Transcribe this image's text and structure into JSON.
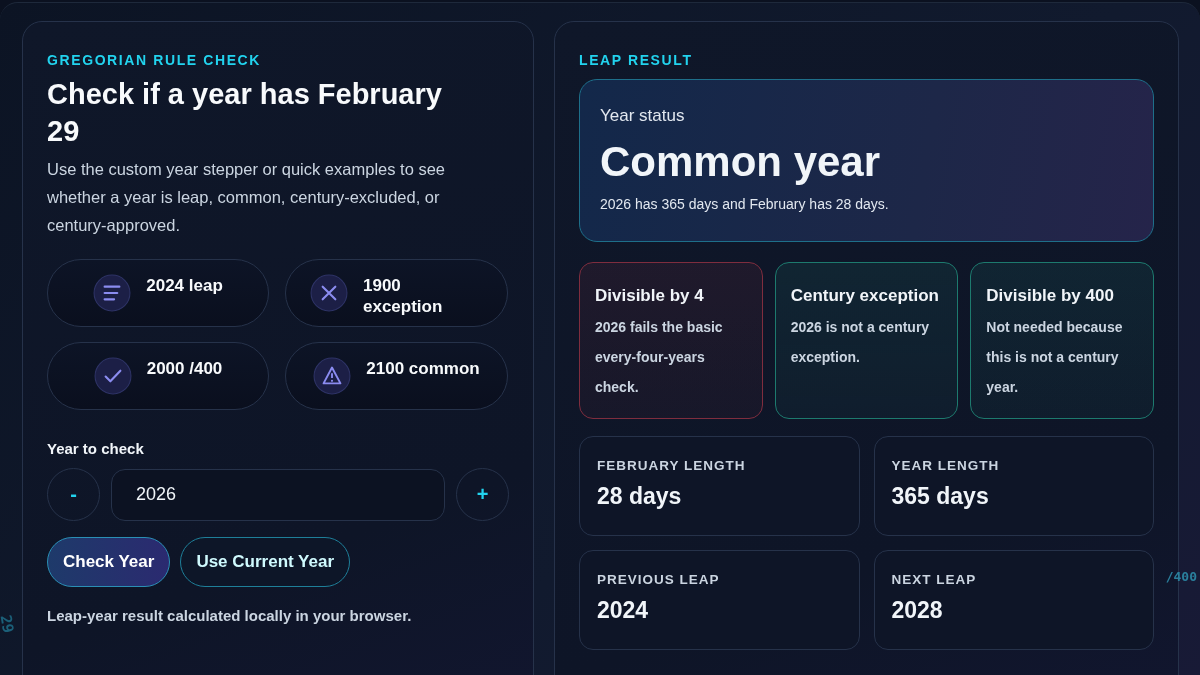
{
  "checker": {
    "eyebrow": "GREGORIAN RULE CHECK",
    "title": "Check if a year has February 29",
    "description": "Use the custom year stepper or quick examples to see whether a year is leap, common, century-excluded, or century-approved.",
    "examples": [
      {
        "kind": "lines",
        "label": "2024 leap"
      },
      {
        "kind": "cross",
        "label": "1900 exception"
      },
      {
        "kind": "check",
        "label": "2000 /400"
      },
      {
        "kind": "warning",
        "label": "2100 common"
      }
    ],
    "year_label": "Year to check",
    "decrement": "-",
    "year_value": "2026",
    "increment": "+",
    "actions": [
      {
        "label": "Check Year",
        "primary": true
      },
      {
        "label": "Use Current Year",
        "primary": false
      }
    ],
    "note": "Leap-year result calculated locally in your browser."
  },
  "background_marks": [
    "29",
    "/400"
  ],
  "result": {
    "eyebrow": "LEAP RESULT",
    "status": {
      "label": "Year status",
      "value": "Common year",
      "detail": "2026 has 365 days and February has 28 days."
    },
    "rules": [
      {
        "title": "Divisible by 4",
        "text": "2026 fails the basic every-four-years check.",
        "color": "#7f2d3e"
      },
      {
        "title": "Century exception",
        "text": "2026 is not a century exception.",
        "color": "#1d7a6e"
      },
      {
        "title": "Divisible by 400",
        "text": "Not needed because this is not a century year.",
        "color": "#1d7a6e"
      }
    ],
    "stats": [
      {
        "label": "FEBRUARY LENGTH",
        "value": "28 days"
      },
      {
        "label": "YEAR LENGTH",
        "value": "365 days"
      },
      {
        "label": "PREVIOUS LEAP",
        "value": "2024"
      },
      {
        "label": "NEXT LEAP",
        "value": "2028"
      }
    ]
  }
}
